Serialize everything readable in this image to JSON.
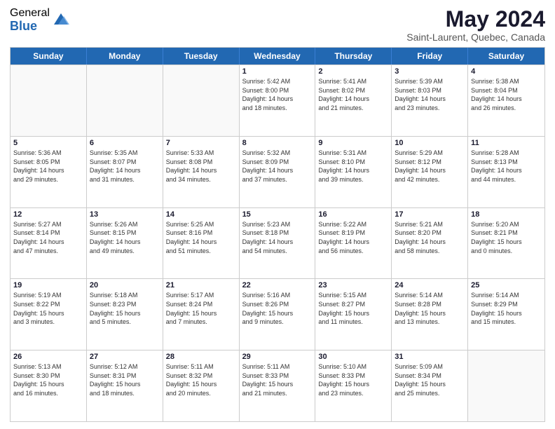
{
  "logo": {
    "general": "General",
    "blue": "Blue"
  },
  "title": {
    "month_year": "May 2024",
    "location": "Saint-Laurent, Quebec, Canada"
  },
  "days": [
    "Sunday",
    "Monday",
    "Tuesday",
    "Wednesday",
    "Thursday",
    "Friday",
    "Saturday"
  ],
  "weeks": [
    [
      {
        "day": "",
        "info": ""
      },
      {
        "day": "",
        "info": ""
      },
      {
        "day": "",
        "info": ""
      },
      {
        "day": "1",
        "info": "Sunrise: 5:42 AM\nSunset: 8:00 PM\nDaylight: 14 hours\nand 18 minutes."
      },
      {
        "day": "2",
        "info": "Sunrise: 5:41 AM\nSunset: 8:02 PM\nDaylight: 14 hours\nand 21 minutes."
      },
      {
        "day": "3",
        "info": "Sunrise: 5:39 AM\nSunset: 8:03 PM\nDaylight: 14 hours\nand 23 minutes."
      },
      {
        "day": "4",
        "info": "Sunrise: 5:38 AM\nSunset: 8:04 PM\nDaylight: 14 hours\nand 26 minutes."
      }
    ],
    [
      {
        "day": "5",
        "info": "Sunrise: 5:36 AM\nSunset: 8:05 PM\nDaylight: 14 hours\nand 29 minutes."
      },
      {
        "day": "6",
        "info": "Sunrise: 5:35 AM\nSunset: 8:07 PM\nDaylight: 14 hours\nand 31 minutes."
      },
      {
        "day": "7",
        "info": "Sunrise: 5:33 AM\nSunset: 8:08 PM\nDaylight: 14 hours\nand 34 minutes."
      },
      {
        "day": "8",
        "info": "Sunrise: 5:32 AM\nSunset: 8:09 PM\nDaylight: 14 hours\nand 37 minutes."
      },
      {
        "day": "9",
        "info": "Sunrise: 5:31 AM\nSunset: 8:10 PM\nDaylight: 14 hours\nand 39 minutes."
      },
      {
        "day": "10",
        "info": "Sunrise: 5:29 AM\nSunset: 8:12 PM\nDaylight: 14 hours\nand 42 minutes."
      },
      {
        "day": "11",
        "info": "Sunrise: 5:28 AM\nSunset: 8:13 PM\nDaylight: 14 hours\nand 44 minutes."
      }
    ],
    [
      {
        "day": "12",
        "info": "Sunrise: 5:27 AM\nSunset: 8:14 PM\nDaylight: 14 hours\nand 47 minutes."
      },
      {
        "day": "13",
        "info": "Sunrise: 5:26 AM\nSunset: 8:15 PM\nDaylight: 14 hours\nand 49 minutes."
      },
      {
        "day": "14",
        "info": "Sunrise: 5:25 AM\nSunset: 8:16 PM\nDaylight: 14 hours\nand 51 minutes."
      },
      {
        "day": "15",
        "info": "Sunrise: 5:23 AM\nSunset: 8:18 PM\nDaylight: 14 hours\nand 54 minutes."
      },
      {
        "day": "16",
        "info": "Sunrise: 5:22 AM\nSunset: 8:19 PM\nDaylight: 14 hours\nand 56 minutes."
      },
      {
        "day": "17",
        "info": "Sunrise: 5:21 AM\nSunset: 8:20 PM\nDaylight: 14 hours\nand 58 minutes."
      },
      {
        "day": "18",
        "info": "Sunrise: 5:20 AM\nSunset: 8:21 PM\nDaylight: 15 hours\nand 0 minutes."
      }
    ],
    [
      {
        "day": "19",
        "info": "Sunrise: 5:19 AM\nSunset: 8:22 PM\nDaylight: 15 hours\nand 3 minutes."
      },
      {
        "day": "20",
        "info": "Sunrise: 5:18 AM\nSunset: 8:23 PM\nDaylight: 15 hours\nand 5 minutes."
      },
      {
        "day": "21",
        "info": "Sunrise: 5:17 AM\nSunset: 8:24 PM\nDaylight: 15 hours\nand 7 minutes."
      },
      {
        "day": "22",
        "info": "Sunrise: 5:16 AM\nSunset: 8:26 PM\nDaylight: 15 hours\nand 9 minutes."
      },
      {
        "day": "23",
        "info": "Sunrise: 5:15 AM\nSunset: 8:27 PM\nDaylight: 15 hours\nand 11 minutes."
      },
      {
        "day": "24",
        "info": "Sunrise: 5:14 AM\nSunset: 8:28 PM\nDaylight: 15 hours\nand 13 minutes."
      },
      {
        "day": "25",
        "info": "Sunrise: 5:14 AM\nSunset: 8:29 PM\nDaylight: 15 hours\nand 15 minutes."
      }
    ],
    [
      {
        "day": "26",
        "info": "Sunrise: 5:13 AM\nSunset: 8:30 PM\nDaylight: 15 hours\nand 16 minutes."
      },
      {
        "day": "27",
        "info": "Sunrise: 5:12 AM\nSunset: 8:31 PM\nDaylight: 15 hours\nand 18 minutes."
      },
      {
        "day": "28",
        "info": "Sunrise: 5:11 AM\nSunset: 8:32 PM\nDaylight: 15 hours\nand 20 minutes."
      },
      {
        "day": "29",
        "info": "Sunrise: 5:11 AM\nSunset: 8:33 PM\nDaylight: 15 hours\nand 21 minutes."
      },
      {
        "day": "30",
        "info": "Sunrise: 5:10 AM\nSunset: 8:33 PM\nDaylight: 15 hours\nand 23 minutes."
      },
      {
        "day": "31",
        "info": "Sunrise: 5:09 AM\nSunset: 8:34 PM\nDaylight: 15 hours\nand 25 minutes."
      },
      {
        "day": "",
        "info": ""
      }
    ]
  ]
}
